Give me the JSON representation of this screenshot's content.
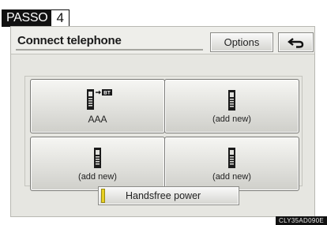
{
  "step": {
    "label": "PASSO",
    "number": "4"
  },
  "header": {
    "title": "Connect telephone",
    "options_label": "Options",
    "back_icon": "return-arrow-icon"
  },
  "phones": [
    {
      "label": "AAA",
      "icon": "phone-bluetooth-icon",
      "bt_badge": "BT"
    },
    {
      "label": "(add new)",
      "icon": "phone-icon"
    },
    {
      "label": "(add new)",
      "icon": "phone-icon"
    },
    {
      "label": "(add new)",
      "icon": "phone-icon"
    }
  ],
  "handsfree": {
    "label": "Handsfree power",
    "indicator_color": "#e8d024"
  },
  "figure_code": "CLY35AD090E"
}
